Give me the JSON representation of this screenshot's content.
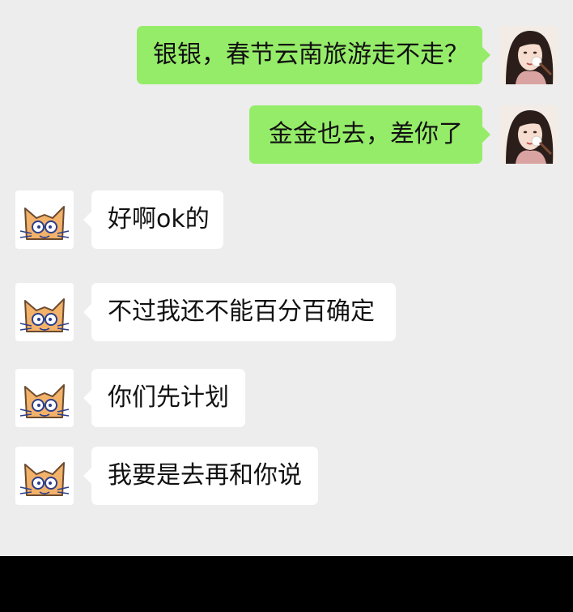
{
  "colors": {
    "chat_background": "#ededed",
    "sent_bubble": "#95ec69",
    "received_bubble": "#ffffff",
    "text": "#111111",
    "bottom_bar": "#000000"
  },
  "contacts": {
    "self_avatar_icon": "woman-portrait-avatar-icon",
    "other_avatar_icon": "orange-cat-avatar-icon"
  },
  "messages": [
    {
      "sender": "self",
      "text": "银银，春节云南旅游走不走？"
    },
    {
      "sender": "self",
      "text": "金金也去，差你了"
    },
    {
      "sender": "other",
      "text": "好啊ok的"
    },
    {
      "sender": "other",
      "text": "不过我还不能百分百确定"
    },
    {
      "sender": "other",
      "text": "你们先计划"
    },
    {
      "sender": "other",
      "text": "我要是去再和你说"
    }
  ]
}
